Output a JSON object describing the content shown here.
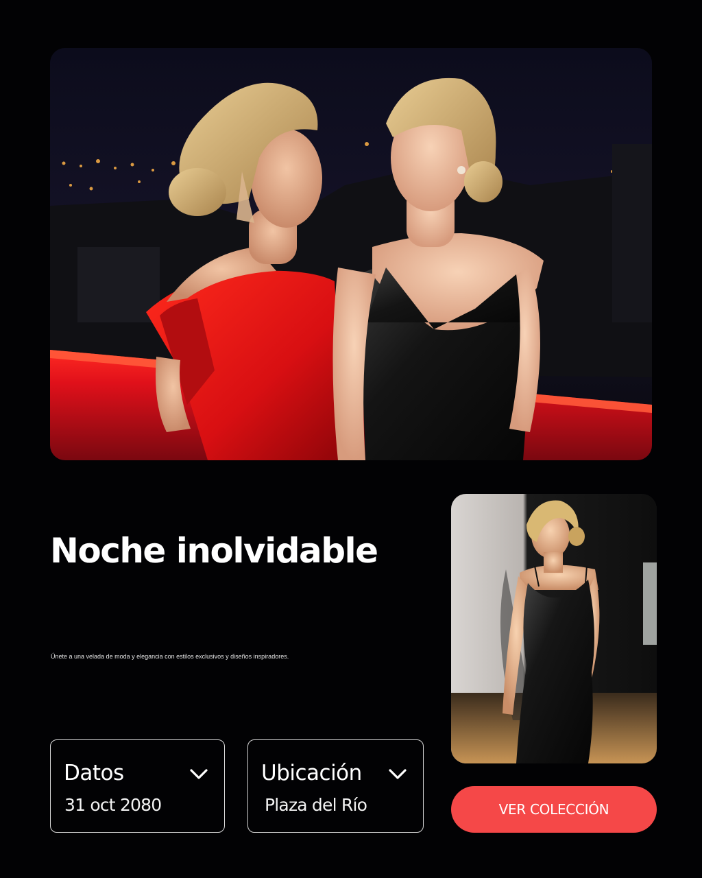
{
  "hero": {
    "image": "photo-two-women-evening-dresses-rooftop-night"
  },
  "headline": {
    "title": "Noche inolvidable",
    "subtitle": "Únete a una velada de moda y elegancia con estilos exclusivos y diseños inspiradores."
  },
  "cards": {
    "date": {
      "label": "Datos",
      "value": "31 oct 2080",
      "icon": "chevron-down-icon"
    },
    "location": {
      "label": "Ubicación",
      "value": "Plaza del Río",
      "icon": "chevron-down-icon"
    }
  },
  "side_photo": {
    "image": "photo-woman-black-slip-dress"
  },
  "cta": {
    "label": "VER COLECCIÓN"
  },
  "colors": {
    "background": "#020204",
    "accent": "#f54848",
    "text": "#ffffff",
    "card_border": "#d9d9d9"
  }
}
